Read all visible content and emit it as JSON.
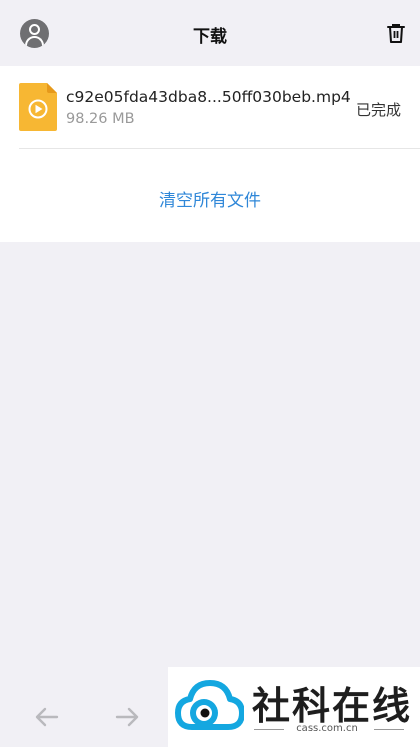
{
  "header": {
    "title": "下载",
    "avatar_icon": "user-avatar-icon",
    "trash_icon": "trash-icon"
  },
  "downloads": [
    {
      "name": "c92e05fda43dba8...50ff030beb.mp4",
      "size": "98.26 MB",
      "status": "已完成",
      "icon": "video-file-icon"
    }
  ],
  "actions": {
    "clear_all": "清空所有文件"
  },
  "nav": {
    "back_icon": "arrow-left-icon",
    "forward_icon": "arrow-right-icon"
  },
  "watermark": {
    "text": "社科在线",
    "url": "cass.com.cn"
  },
  "colors": {
    "background": "#f1f0f5",
    "link": "#2f87d8",
    "file_icon": "#f7b733"
  }
}
